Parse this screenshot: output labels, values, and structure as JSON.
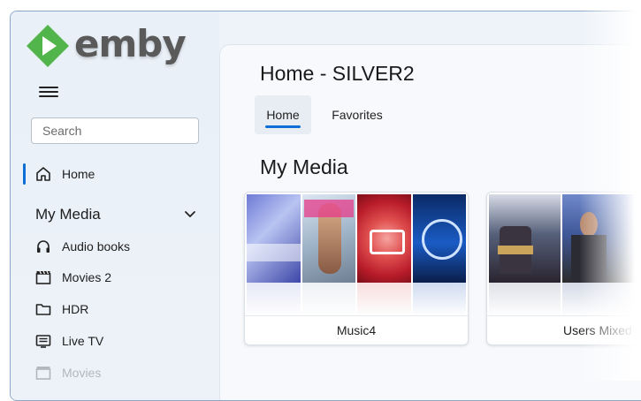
{
  "app": {
    "logo_text": "emby",
    "brand_green": "#52b54b",
    "accent": "#0d6fd6"
  },
  "sidebar": {
    "search": {
      "placeholder": "Search",
      "value": ""
    },
    "home_label": "Home",
    "section_title": "My Media",
    "items": [
      {
        "label": "Audio books",
        "icon": "headphones-icon"
      },
      {
        "label": "Movies 2",
        "icon": "clapperboard-icon"
      },
      {
        "label": "HDR",
        "icon": "folder-icon"
      },
      {
        "label": "Live TV",
        "icon": "tv-guide-icon"
      },
      {
        "label": "Movies",
        "icon": "clapperboard-icon"
      }
    ]
  },
  "main": {
    "page_title": "Home - SILVER2",
    "tabs": [
      {
        "label": "Home",
        "active": true
      },
      {
        "label": "Favorites",
        "active": false
      }
    ],
    "section_title": "My Media",
    "libraries": [
      {
        "name": "Music4"
      },
      {
        "name": "Users Mixed"
      }
    ]
  }
}
